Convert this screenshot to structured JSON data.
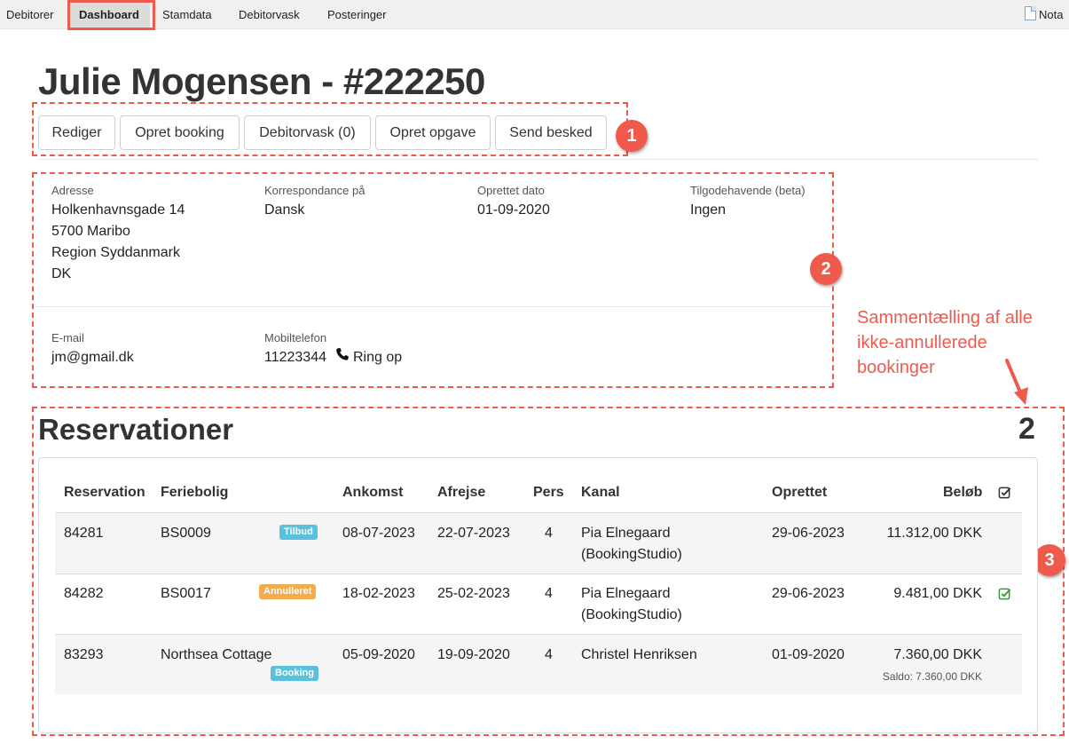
{
  "nav": {
    "items": [
      "Debitorer",
      "Dashboard",
      "Stamdata",
      "Debitorvask",
      "Posteringer"
    ],
    "active": "Dashboard",
    "nota_label": "Nota",
    "nota_icon": "document-icon"
  },
  "header": {
    "title": "Julie Mogensen - #222250"
  },
  "actions": [
    "Rediger",
    "Opret booking",
    "Debitorvask (0)",
    "Opret opgave",
    "Send besked"
  ],
  "badges": [
    "1",
    "2",
    "3"
  ],
  "details": {
    "address_label": "Adresse",
    "address_lines": [
      "Holkenhavnsgade 14",
      "5700 Maribo",
      "Region Syddanmark",
      "DK"
    ],
    "correspondence_label": "Korrespondance på",
    "correspondence_value": "Dansk",
    "created_label": "Oprettet dato",
    "created_value": "01-09-2020",
    "credit_label": "Tilgodehavende (beta)",
    "credit_value": "Ingen",
    "email_label": "E-mail",
    "email_value": "jm@gmail.dk",
    "mobile_label": "Mobiltelefon",
    "mobile_value": "11223344",
    "call_label": "Ring op",
    "call_icon": "phone-icon"
  },
  "annotation": {
    "lines": [
      "Sammentælling af alle",
      "ikke-annullerede",
      "bookinger"
    ]
  },
  "reservations": {
    "title": "Reservationer",
    "count": "2",
    "columns": [
      "Reservation",
      "Feriebolig",
      "Ankomst",
      "Afrejse",
      "Pers",
      "Kanal",
      "Oprettet",
      "Beløb"
    ],
    "check_header_icon": "check-square-icon",
    "rows": [
      {
        "reservation": "84281",
        "property": "BS0009",
        "tag": "Tilbud",
        "arrival": "08-07-2023",
        "departure": "22-07-2023",
        "pers": "4",
        "channel_lines": [
          "Pia Elnegaard",
          "(BookingStudio)"
        ],
        "created": "29-06-2023",
        "amount": "11.312,00 DKK",
        "saldo": "",
        "checked": false
      },
      {
        "reservation": "84282",
        "property": "BS0017",
        "tag": "Annulleret",
        "arrival": "18-02-2023",
        "departure": "25-02-2023",
        "pers": "4",
        "channel_lines": [
          "Pia Elnegaard",
          "(BookingStudio)"
        ],
        "created": "29-06-2023",
        "amount": "9.481,00 DKK",
        "saldo": "",
        "checked": true
      },
      {
        "reservation": "83293",
        "property": "Northsea Cottage",
        "tag": "Booking",
        "arrival": "05-09-2020",
        "departure": "19-09-2020",
        "pers": "4",
        "channel_lines": [
          "Christel Henriksen"
        ],
        "created": "01-09-2020",
        "amount": "7.360,00 DKK",
        "saldo": "Saldo: 7.360,00 DKK",
        "checked": false
      }
    ]
  },
  "colors": {
    "annotation": "#ef5a4c",
    "tag_blue": "#5bc0de",
    "tag_orange": "#f0ad4e",
    "check_green": "#3c9a3c"
  }
}
